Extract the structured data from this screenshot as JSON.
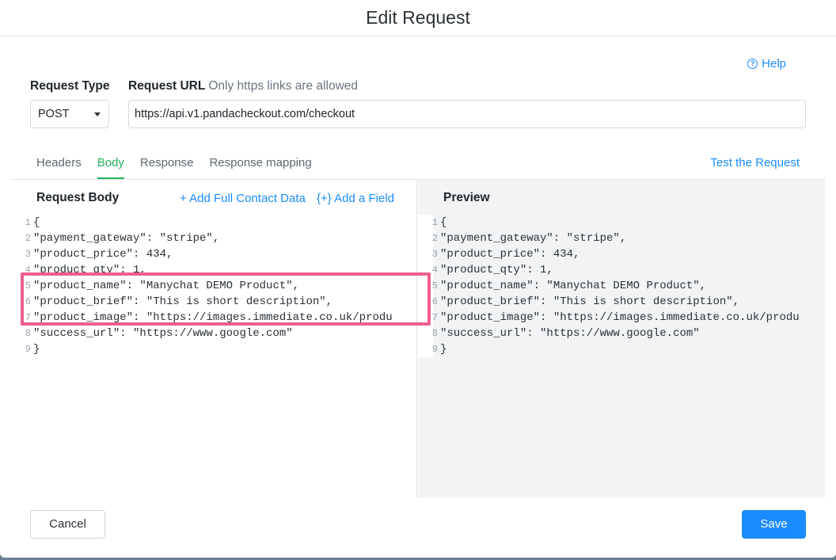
{
  "modal": {
    "title": "Edit Request"
  },
  "help": {
    "label": "Help",
    "icon": "help-circle-icon"
  },
  "request_type": {
    "label": "Request Type",
    "value": "POST"
  },
  "request_url": {
    "label": "Request URL",
    "note": "Only https links are allowed",
    "value": "https://api.v1.pandacheckout.com/checkout"
  },
  "tabs": [
    {
      "label": "Headers",
      "active": false
    },
    {
      "label": "Body",
      "active": true
    },
    {
      "label": "Response",
      "active": false
    },
    {
      "label": "Response mapping",
      "active": false
    }
  ],
  "test_request": {
    "label": "Test the Request"
  },
  "request_body": {
    "title": "Request Body",
    "add_contact_label": "+ Add Full Contact Data",
    "add_field_label": "{+} Add a Field",
    "lines": [
      {
        "num": "1",
        "text": "{"
      },
      {
        "num": "2",
        "text": "\"payment_gateway\": \"stripe\","
      },
      {
        "num": "3",
        "text": "\"product_price\": 434,"
      },
      {
        "num": "4",
        "text": "\"product_qty\": 1,"
      },
      {
        "num": "5",
        "text": "\"product_name\": \"Manychat DEMO Product\","
      },
      {
        "num": "6",
        "text": "\"product_brief\": \"This is short description\","
      },
      {
        "num": "7",
        "text": "\"product_image\": \"https://images.immediate.co.uk/produ"
      },
      {
        "num": "8",
        "text": "\"success_url\": \"https://www.google.com\""
      },
      {
        "num": "9",
        "text": "}"
      }
    ]
  },
  "preview": {
    "title": "Preview",
    "lines": [
      {
        "num": "1",
        "text": "{"
      },
      {
        "num": "2",
        "text": "\"payment_gateway\": \"stripe\","
      },
      {
        "num": "3",
        "text": "\"product_price\": 434,"
      },
      {
        "num": "4",
        "text": "\"product_qty\": 1,"
      },
      {
        "num": "5",
        "text": "\"product_name\": \"Manychat DEMO Product\","
      },
      {
        "num": "6",
        "text": "\"product_brief\": \"This is short description\","
      },
      {
        "num": "7",
        "text": "\"product_image\": \"https://images.immediate.co.uk/produ"
      },
      {
        "num": "8",
        "text": "\"success_url\": \"https://www.google.com\""
      },
      {
        "num": "9",
        "text": "}"
      }
    ]
  },
  "footer": {
    "cancel_label": "Cancel",
    "save_label": "Save"
  },
  "colors": {
    "accent": "#1a8cff",
    "active_tab": "#26b05b",
    "highlight": "#ec5f8a",
    "preview_bg": "#f2f3f4"
  }
}
